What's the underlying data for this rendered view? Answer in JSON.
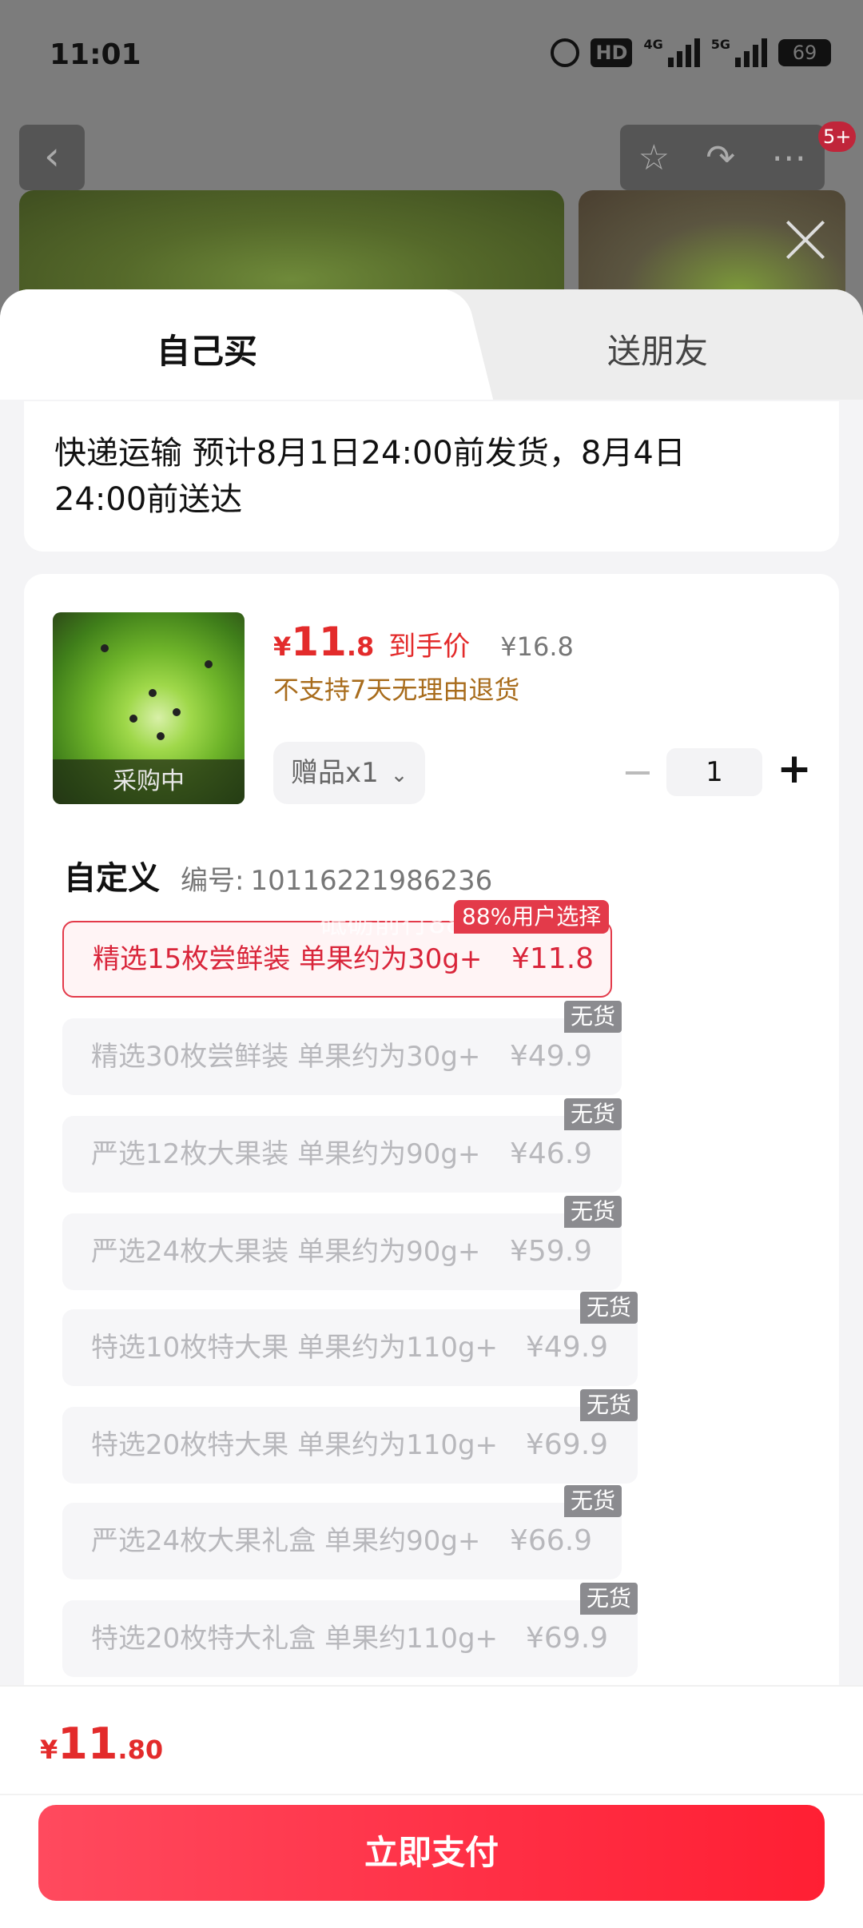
{
  "status_bar": {
    "time": "11:01",
    "hd_label": "HD",
    "network_1": "4G",
    "network_2": "5G",
    "battery": "69"
  },
  "header": {
    "notification_count": "5+"
  },
  "tabs": {
    "buy_self": "自己买",
    "gift_friend": "送朋友"
  },
  "shipping": {
    "text": "快递运输 预计8月1日24:00前发货，8月4日24:00前送达"
  },
  "product": {
    "image_overlay": "采购中",
    "price_currency": "¥",
    "price_int": "11",
    "price_dec": ".8",
    "price_tag": "到手价",
    "original_price": "¥16.8",
    "return_policy": "不支持7天无理由退货",
    "gift_chip": "赠品x1",
    "quantity": "1"
  },
  "spec": {
    "title": "自定义",
    "code_label": "编号:",
    "code_value": "10116221986236",
    "hot_badge": "88%用户选择",
    "watermark": "砥砺前行88",
    "out_of_stock": "无货",
    "options": [
      {
        "name": "精选15枚尝鲜装 单果约为30g+",
        "price": "¥11.8"
      },
      {
        "name": "精选30枚尝鲜装 单果约为30g+",
        "price": "¥49.9"
      },
      {
        "name": "严选12枚大果装 单果约为90g+",
        "price": "¥46.9"
      },
      {
        "name": "严选24枚大果装 单果约为90g+",
        "price": "¥59.9"
      },
      {
        "name": "特选10枚特大果 单果约为110g+",
        "price": "¥49.9"
      },
      {
        "name": "特选20枚特大果 单果约为110g+",
        "price": "¥69.9"
      },
      {
        "name": "严选24枚大果礼盒 单果约90g+",
        "price": "¥66.9"
      },
      {
        "name": "特选20枚特大礼盒 单果约110g+",
        "price": "¥69.9"
      }
    ]
  },
  "footer": {
    "total_currency": "¥",
    "total_int": "11",
    "total_dec": ".80",
    "pay_button": "立即支付"
  },
  "colors": {
    "accent": "#e32b2b",
    "pay_button": "#ff2e44",
    "warning_text": "#a86c1c",
    "badge_gray": "#8b8b8f"
  }
}
